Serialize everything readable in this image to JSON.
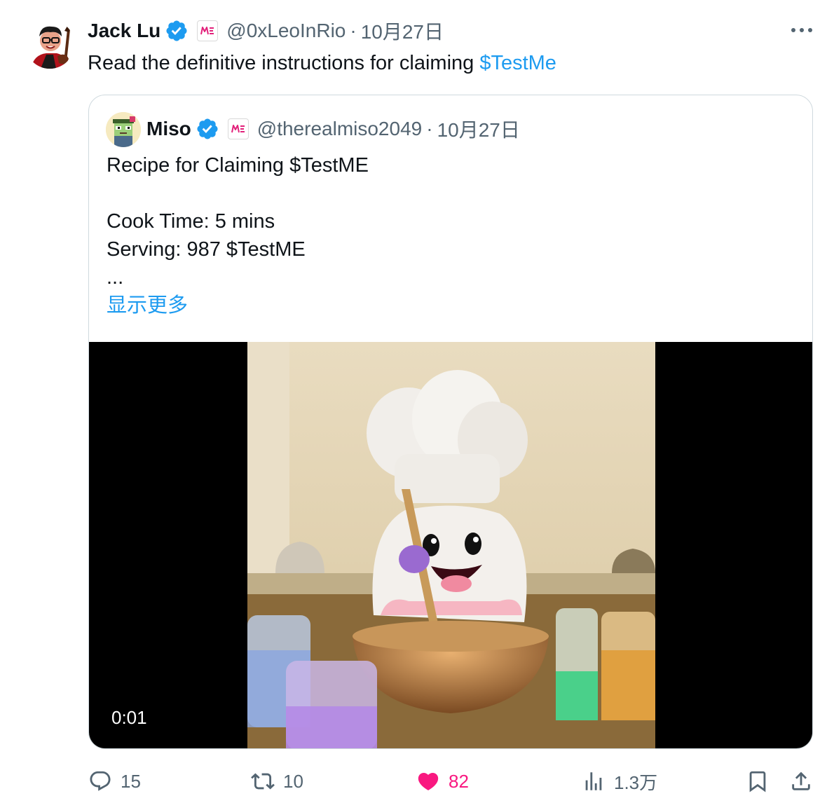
{
  "tweet": {
    "author": {
      "name": "Jack Lu",
      "handle": "@0xLeoInRio",
      "date": "10月27日",
      "separator": "·",
      "avatar_icon": "illustrated-portrait-avatar",
      "verified_icon": "verified-badge-icon",
      "affiliation_icon": "magic-eden-badge-icon"
    },
    "text_prefix": "Read the definitive instructions for claiming ",
    "cashtag": "$TestMe",
    "more_icon": "more-options-icon"
  },
  "quote": {
    "author": {
      "name": "Miso",
      "handle": "@therealmiso2049",
      "date": "10月27日",
      "separator": "·",
      "avatar_icon": "pixel-character-avatar"
    },
    "lines": [
      "Recipe for Claiming $TestME",
      "",
      "Cook Time: 5 mins",
      "Serving: 987 $TestME",
      "..."
    ],
    "show_more": "显示更多",
    "video": {
      "timestamp": "0:01",
      "description_icon": "video-thumbnail"
    }
  },
  "actions": {
    "reply": {
      "icon": "reply-icon",
      "count": "15"
    },
    "repost": {
      "icon": "repost-icon",
      "count": "10"
    },
    "like": {
      "icon": "heart-icon",
      "count": "82",
      "liked": true
    },
    "views": {
      "icon": "views-icon",
      "count": "1.3万"
    },
    "bookmark": {
      "icon": "bookmark-icon"
    },
    "share": {
      "icon": "share-icon"
    }
  },
  "colors": {
    "accent": "#1d9bf0",
    "like": "#f91880",
    "secondary_text": "#536471",
    "border": "#cfd9de",
    "badge": "#e2227b"
  }
}
